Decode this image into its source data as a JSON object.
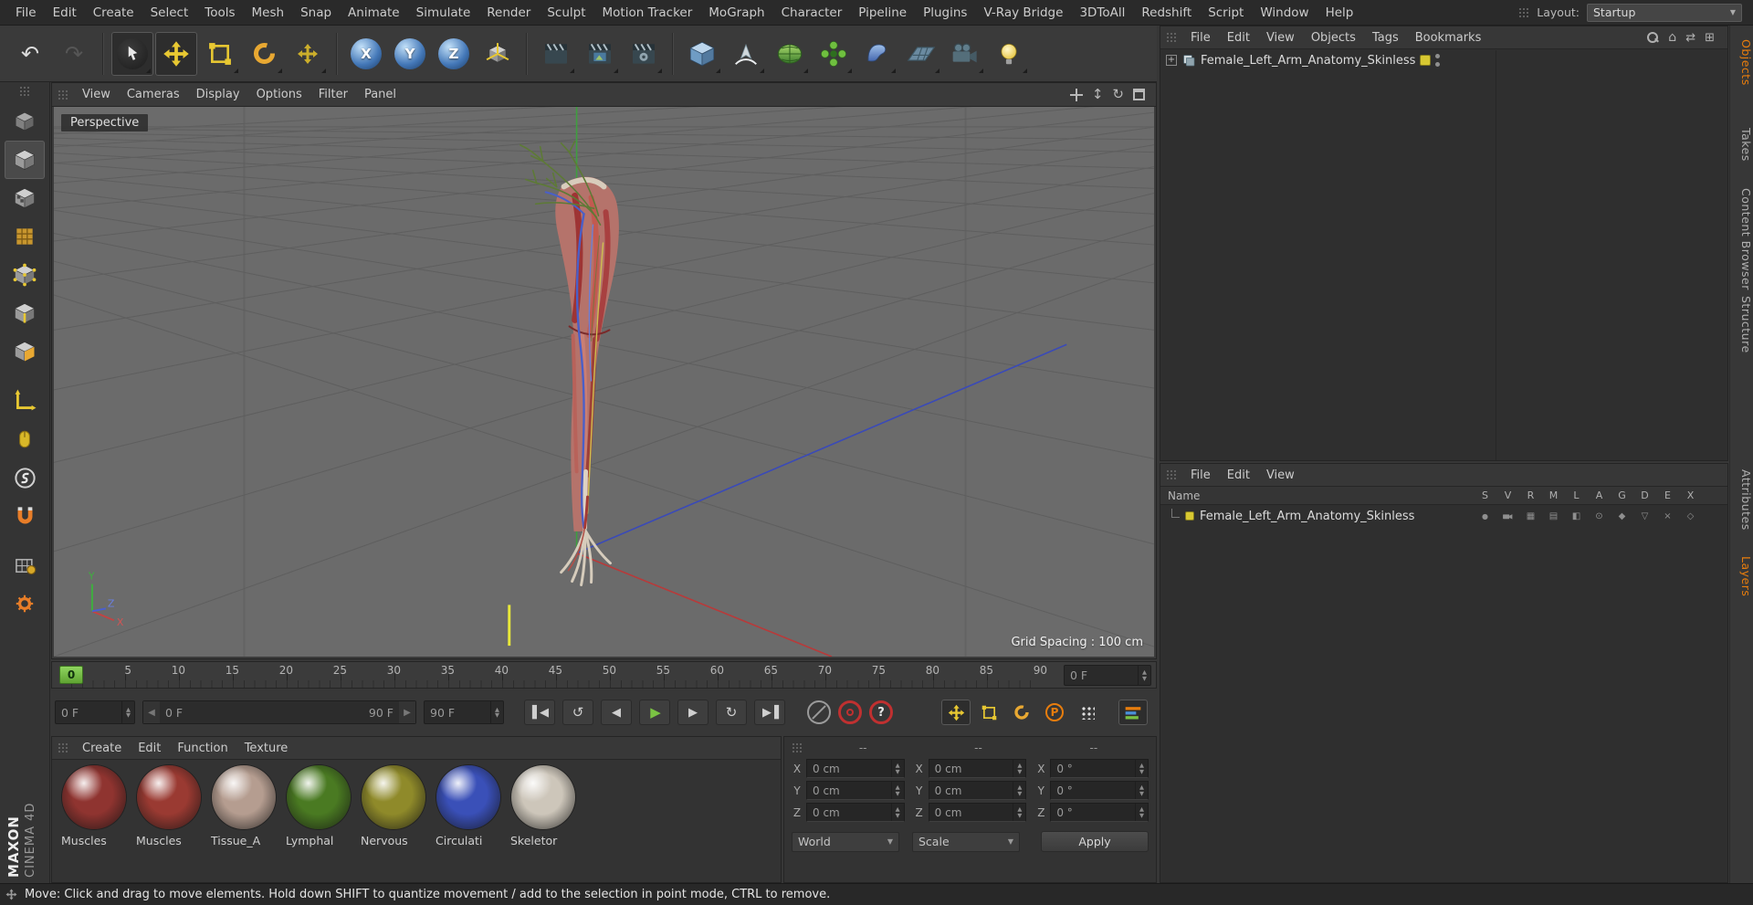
{
  "accent": {
    "orange": "#e87d0d",
    "tool_yellow": "#e8c832",
    "marker_green": "#76c043",
    "axis_blue_button": "#4478b8"
  },
  "menubar": {
    "items": [
      "File",
      "Edit",
      "Create",
      "Select",
      "Tools",
      "Mesh",
      "Snap",
      "Animate",
      "Simulate",
      "Render",
      "Sculpt",
      "Motion Tracker",
      "MoGraph",
      "Character",
      "Pipeline",
      "Plugins",
      "V-Ray Bridge",
      "3DToAll",
      "Redshift",
      "Script",
      "Window",
      "Help"
    ],
    "layout_label": "Layout:",
    "layout_value": "Startup"
  },
  "toolbar": {
    "axis_locks": [
      "X",
      "Y",
      "Z"
    ],
    "icons": [
      "undo",
      "redo",
      "live-selection",
      "move",
      "scale",
      "rotate",
      "last-tool",
      "lock-x",
      "lock-y",
      "lock-z",
      "coordinate-system",
      "render-view",
      "render-picture-viewer",
      "render-settings",
      "primitive-cube",
      "spline-pen",
      "subdivision-surface",
      "mograph",
      "deformer",
      "environment",
      "camera",
      "light"
    ]
  },
  "sidebar": {
    "icons": [
      "make-editable",
      "model-mode",
      "texture-mode",
      "uv-mode",
      "points-mode",
      "edges-mode",
      "polygons-mode",
      "axis-mode",
      "tweak-mode",
      "snap",
      "magnet",
      "workplane-lock",
      "gear"
    ]
  },
  "viewport": {
    "label": "Perspective",
    "menu": [
      "View",
      "Cameras",
      "Display",
      "Options",
      "Filter",
      "Panel"
    ],
    "nav_icons": [
      "pan",
      "zoom",
      "rotate",
      "maximize"
    ],
    "grid_spacing": "Grid Spacing : 100 cm",
    "axis": {
      "x": "X",
      "y": "Y",
      "z": "Z"
    }
  },
  "timeline": {
    "marker": "0",
    "ticks": [
      "5",
      "10",
      "15",
      "20",
      "25",
      "30",
      "35",
      "40",
      "45",
      "50",
      "55",
      "60",
      "65",
      "70",
      "75",
      "80",
      "85",
      "90"
    ],
    "frame_field": "0 F"
  },
  "transport": {
    "current": "0 F",
    "range_start": "0 F",
    "range_end": "90 F",
    "end": "90 F",
    "help": "?",
    "p_label": "P"
  },
  "materials": {
    "menu": [
      "Create",
      "Edit",
      "Function",
      "Texture"
    ],
    "items": [
      {
        "name": "Muscles",
        "color": "#8f3430"
      },
      {
        "name": "Muscles",
        "color": "#9a3a32"
      },
      {
        "name": "Tissue_A",
        "color": "#b59d90"
      },
      {
        "name": "Lymphal",
        "color": "#4a7a22"
      },
      {
        "name": "Nervous",
        "color": "#8f8a2a"
      },
      {
        "name": "Circulati",
        "color": "#3a50b8"
      },
      {
        "name": "Skeletor",
        "color": "#cdc6ba"
      }
    ]
  },
  "coordinates": {
    "headers": [
      "--",
      "--",
      "--"
    ],
    "axis_labels": [
      "X",
      "Y",
      "Z"
    ],
    "position": {
      "x": "0 cm",
      "y": "0 cm",
      "z": "0 cm"
    },
    "size": {
      "x": "0 cm",
      "y": "0 cm",
      "z": "0 cm"
    },
    "rotation": {
      "x": "0 °",
      "y": "0 °",
      "z": "0 °"
    },
    "space": "World",
    "mode": "Scale",
    "apply": "Apply"
  },
  "object_manager": {
    "menu": [
      "File",
      "Edit",
      "View",
      "Objects",
      "Tags",
      "Bookmarks"
    ],
    "object_name": "Female_Left_Arm_Anatomy_Skinless",
    "layer_color": "#d8c832"
  },
  "layer_manager": {
    "menu": [
      "File",
      "Edit",
      "View"
    ],
    "name_header": "Name",
    "columns": [
      "S",
      "V",
      "R",
      "M",
      "L",
      "A",
      "G",
      "D",
      "E",
      "X"
    ],
    "layer_name": "Female_Left_Arm_Anatomy_Skinless",
    "layer_color": "#d8c832"
  },
  "right_tabs": {
    "top": [
      "Objects",
      "Takes",
      "Content Browser",
      "Structure"
    ],
    "bottom": [
      "Attributes",
      "Layers"
    ]
  },
  "status_bar": {
    "text": "Move: Click and drag to move elements. Hold down SHIFT to quantize movement / add to the selection in point mode, CTRL to remove."
  },
  "branding": {
    "line1": "MAXON",
    "line2": "CINEMA 4D"
  }
}
